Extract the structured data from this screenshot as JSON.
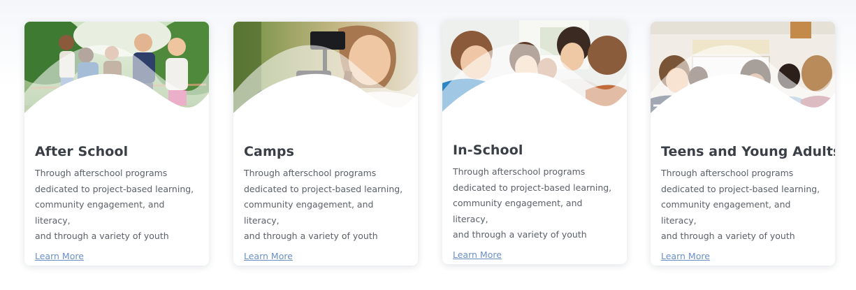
{
  "cards": [
    {
      "title": "After School",
      "desc_lines": [
        "Through afterschool programs",
        "dedicated to project-based learning,",
        "community engagement, and literacy,",
        "and through a variety of youth"
      ],
      "link": "Learn More",
      "image": "children-tug-of-war-photo"
    },
    {
      "title": "Camps",
      "desc_lines": [
        "Through afterschool programs",
        "dedicated to project-based learning,",
        "community engagement, and literacy,",
        "and through a variety of youth"
      ],
      "link": "Learn More",
      "image": "girl-with-video-camera-photo"
    },
    {
      "title": "In-School",
      "desc_lines": [
        "Through afterschool programs",
        "dedicated to project-based learning,",
        "community engagement, and literacy,",
        "and through a variety of youth"
      ],
      "link": "Learn More",
      "image": "students-at-classroom-table-photo"
    },
    {
      "title": "Teens and Young Adults",
      "desc_lines": [
        "Through afterschool programs",
        "dedicated to project-based learning,",
        "community engagement, and literacy,",
        "and through a variety of youth"
      ],
      "link": "Learn More",
      "image": "teens-in-classroom-photo"
    }
  ],
  "colors": {
    "title": "#3a3f47",
    "text": "#5b6068",
    "link": "#6a8fc4",
    "background": "#ffffff"
  }
}
